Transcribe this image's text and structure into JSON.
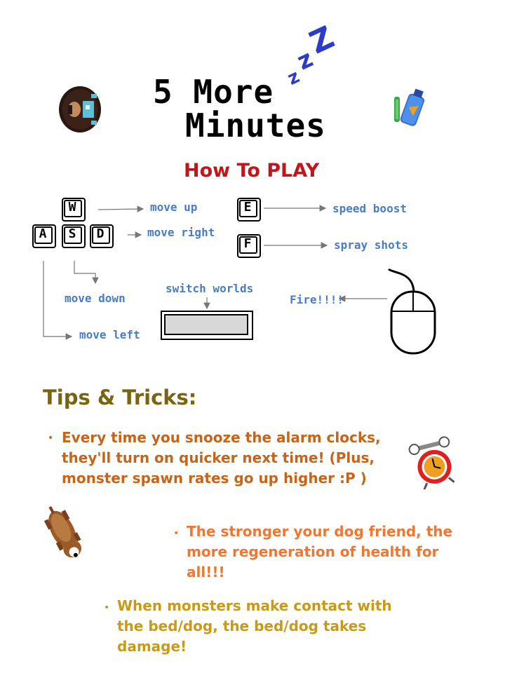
{
  "title": {
    "line1": "5 More",
    "line2": "Minutes",
    "zzz": [
      "z",
      "z",
      "Z"
    ]
  },
  "how_to": {
    "heading": "How To PLAY"
  },
  "keys": {
    "w": "W",
    "a": "A",
    "s": "S",
    "d": "D",
    "e": "E",
    "f": "F"
  },
  "controls": {
    "move_up": "move up",
    "move_right": "move right",
    "move_down": "move down",
    "move_left": "move left",
    "speed_boost": "speed boost",
    "spray_shots": "spray shots",
    "switch_worlds": "switch worlds",
    "fire": "Fire!!!!"
  },
  "tips": {
    "heading": "Tips & Tricks:",
    "tip1": "Every time you snooze the alarm clocks, they'll turn on quicker next time! (Plus, monster spawn rates go up higher :P )",
    "tip2": "The stronger your dog friend, the more regeneration of health for all!!!",
    "tip3": "When monsters make contact with the bed/dog, the bed/dog takes damage!"
  },
  "colors": {
    "blue_label": "#4a7cc4",
    "red_heading": "#c0181a",
    "tips_heading": "#7a6410",
    "tip1": "#c86418",
    "tip2": "#ee7832",
    "tip3": "#c89a18",
    "zzz": "#2c3cc8"
  },
  "icons": [
    "player-in-bed-icon",
    "spray-can-icon",
    "alarm-clock-icon",
    "dog-icon",
    "mouse-icon",
    "spacebar-icon"
  ]
}
